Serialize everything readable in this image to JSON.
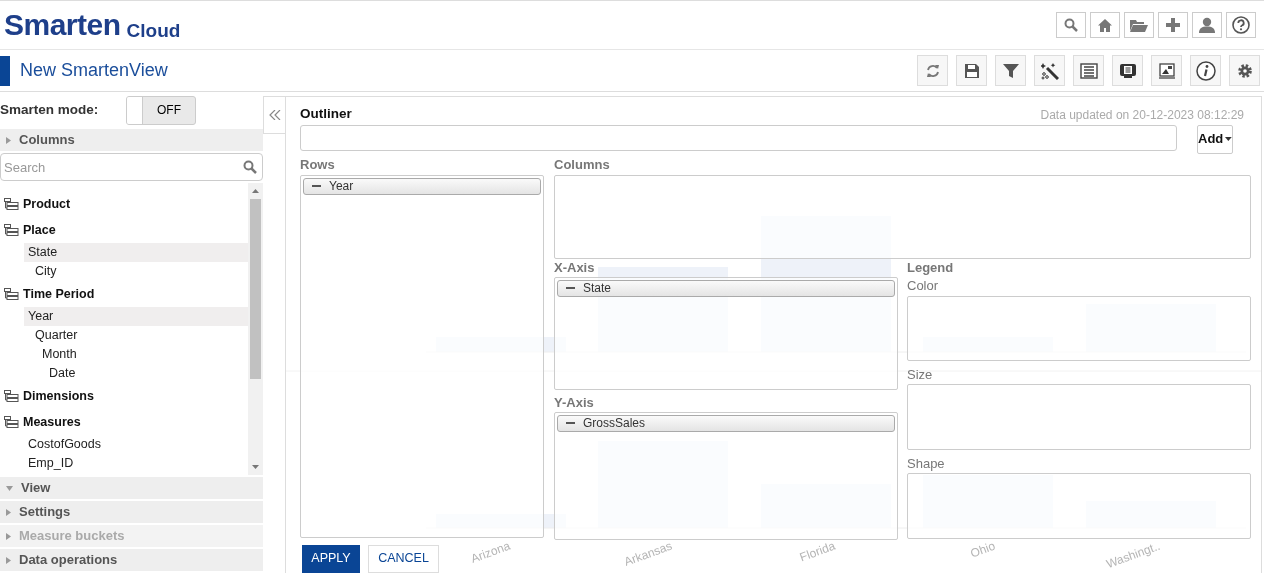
{
  "header": {
    "logo": "Smarten",
    "logo_suffix": "Cloud"
  },
  "view_bar": {
    "title": "New SmartenView"
  },
  "sidebar": {
    "smarten_mode": {
      "label": "Smarten mode:",
      "on": false,
      "state_text": "OFF"
    },
    "sections": [
      {
        "label": "Columns",
        "expanded": false,
        "disabled": false
      },
      {
        "label": "View",
        "expanded": true,
        "disabled": false
      },
      {
        "label": "Settings",
        "expanded": false,
        "disabled": false
      },
      {
        "label": "Measure buckets",
        "expanded": false,
        "disabled": true
      },
      {
        "label": "Data operations",
        "expanded": false,
        "disabled": false
      }
    ],
    "search": {
      "placeholder": "Search"
    },
    "tree": [
      {
        "label": "Product",
        "kind": "group"
      },
      {
        "label": "Place",
        "kind": "group",
        "children": [
          {
            "label": "State",
            "kind": "field",
            "selected": true,
            "children": [
              {
                "label": "City",
                "kind": "field",
                "selected": false
              }
            ]
          }
        ]
      },
      {
        "label": "Time Period",
        "kind": "group",
        "children": [
          {
            "label": "Year",
            "kind": "field",
            "selected": true,
            "children": [
              {
                "label": "Quarter",
                "kind": "field",
                "selected": false,
                "children": [
                  {
                    "label": "Month",
                    "kind": "field",
                    "selected": false,
                    "children": [
                      {
                        "label": "Date",
                        "kind": "field",
                        "selected": false
                      }
                    ]
                  }
                ]
              }
            ]
          }
        ]
      },
      {
        "label": "Dimensions",
        "kind": "group"
      },
      {
        "label": "Measures",
        "kind": "group",
        "children": [
          {
            "label": "CostofGoods",
            "kind": "field",
            "selected": false
          },
          {
            "label": "Emp_ID",
            "kind": "field",
            "selected": false
          }
        ]
      }
    ]
  },
  "chart": {
    "data_updated": "Data updated on 20-12-2023 08:12:29",
    "x_labels": [
      "Arizona",
      "Arkansas",
      "Florida",
      "Ohio",
      "Washingt.."
    ]
  },
  "outliner": {
    "title": "Outliner",
    "add_button": "Add",
    "rows": {
      "label": "Rows",
      "chips": [
        "Year"
      ]
    },
    "columns": {
      "label": "Columns"
    },
    "x_axis": {
      "label": "X-Axis",
      "chips": [
        "State"
      ]
    },
    "y_axis": {
      "label": "Y-Axis",
      "chips": [
        "GrossSales"
      ]
    },
    "legend": {
      "label": "Legend",
      "color": {
        "label": "Color"
      },
      "size": {
        "label": "Size"
      },
      "shape": {
        "label": "Shape"
      }
    },
    "buttons": {
      "apply": "APPLY",
      "cancel": "CANCEL"
    }
  }
}
